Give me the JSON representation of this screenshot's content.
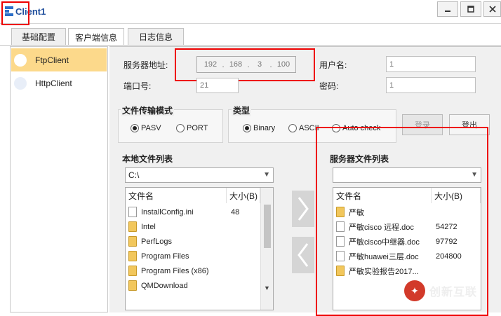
{
  "window": {
    "title": "Client1"
  },
  "tabs": [
    "基础配置",
    "客户端信息",
    "日志信息"
  ],
  "sidebar": {
    "items": [
      {
        "label": "FtpClient"
      },
      {
        "label": "HttpClient"
      }
    ]
  },
  "form": {
    "server_label": "服务器地址:",
    "ip": [
      "192",
      "168",
      "3",
      "100"
    ],
    "port_label": "端口号:",
    "port_value": "21",
    "user_label": "用户名:",
    "user_value": "1",
    "pass_label": "密码:",
    "pass_value": "1"
  },
  "transfer": {
    "title": "文件传输模式",
    "options": [
      "PASV",
      "PORT"
    ],
    "selected": "PASV"
  },
  "type": {
    "title": "类型",
    "options": [
      "Binary",
      "ASCII",
      "Auto check"
    ],
    "selected": "Binary"
  },
  "buttons": {
    "login": "登录",
    "logout": "登出"
  },
  "local": {
    "title": "本地文件列表",
    "path": "C:\\",
    "headers": [
      "文件名",
      "大小(B)"
    ],
    "rows": [
      {
        "name": "InstallConfig.ini",
        "size": "48",
        "kind": "file"
      },
      {
        "name": "Intel",
        "size": "",
        "kind": "folder"
      },
      {
        "name": "PerfLogs",
        "size": "",
        "kind": "folder"
      },
      {
        "name": "Program Files",
        "size": "",
        "kind": "folder"
      },
      {
        "name": "Program Files (x86)",
        "size": "",
        "kind": "folder"
      },
      {
        "name": "QMDownload",
        "size": "",
        "kind": "folder"
      }
    ]
  },
  "server": {
    "title": "服务器文件列表",
    "path": "",
    "headers": [
      "文件名",
      "大小(B)"
    ],
    "rows": [
      {
        "name": "严敏",
        "size": "",
        "kind": "folder"
      },
      {
        "name": "严敏cisco 远程.doc",
        "size": "54272",
        "kind": "file"
      },
      {
        "name": "严敏cisco中继器.doc",
        "size": "97792",
        "kind": "file"
      },
      {
        "name": "严敏huawei三层.doc",
        "size": "204800",
        "kind": "file"
      },
      {
        "name": "严敏实验报告2017...",
        "size": "",
        "kind": "folder"
      }
    ]
  },
  "watermark": {
    "text": "创新互联"
  },
  "colors": {
    "selected_item": "#fcd98b",
    "highlight": "#e00000",
    "title": "#1f4e9c"
  }
}
